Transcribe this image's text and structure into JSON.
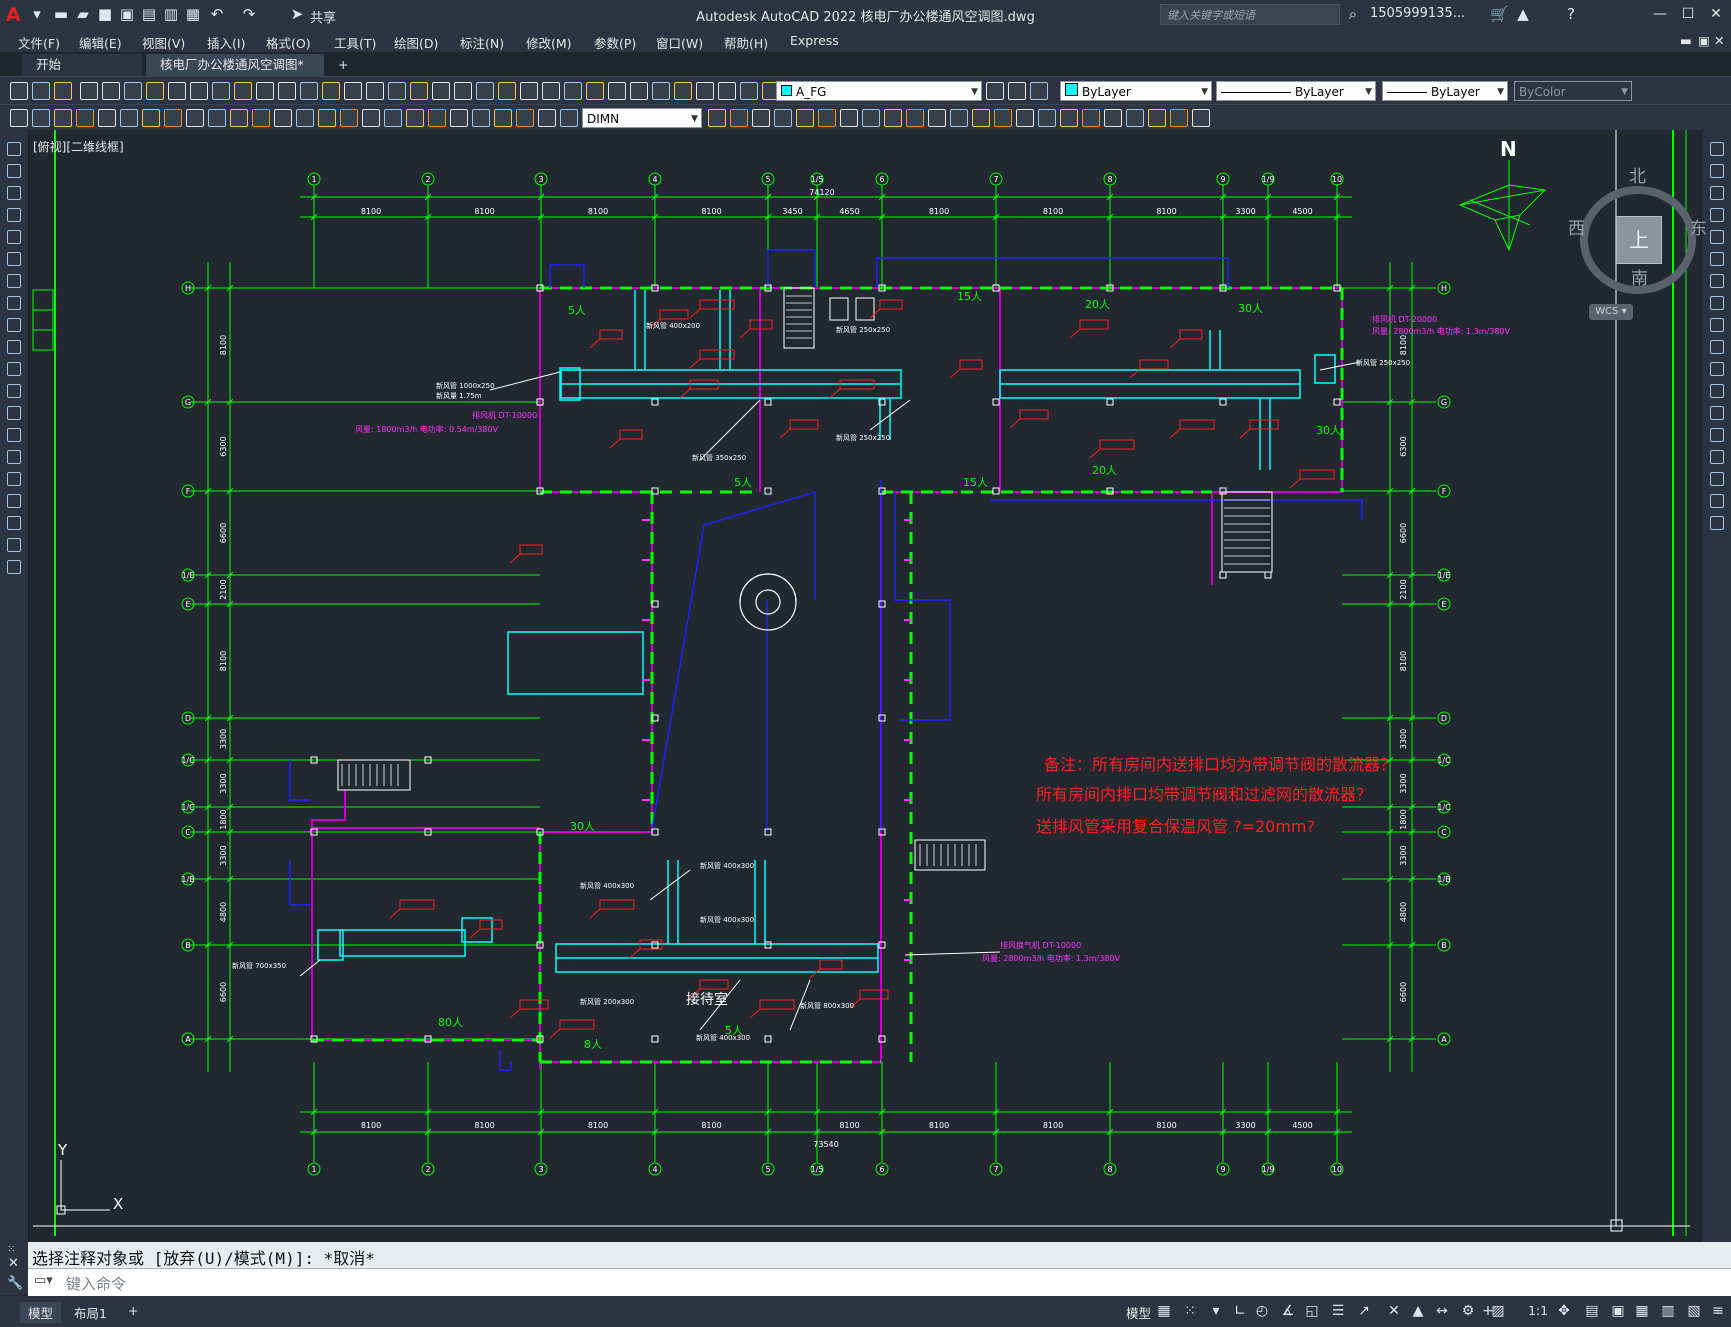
{
  "app": {
    "window_title": "Autodesk AutoCAD 2022    核电厂办公楼通风空调图.dwg",
    "share_label": "共享",
    "search_placeholder": "键入关键字或短语",
    "user": "1505999135...",
    "logo": "A"
  },
  "menu": [
    "文件(F)",
    "编辑(E)",
    "视图(V)",
    "插入(I)",
    "格式(O)",
    "工具(T)",
    "绘图(D)",
    "标注(N)",
    "修改(M)",
    "参数(P)",
    "窗口(W)",
    "帮助(H)",
    "Express"
  ],
  "tabs": {
    "start": "开始",
    "document": "核电厂办公楼通风空调图*",
    "add": "+"
  },
  "toolbar": {
    "layer": "A_FG",
    "color": "ByLayer",
    "linetype": "ByLayer",
    "lineweight": "ByLayer",
    "plotstyle": "ByColor",
    "dimstyle": "DIMN"
  },
  "viewport": {
    "label": "[俯视][二维线框]",
    "viewcube": {
      "north": "北",
      "south": "南",
      "east": "东",
      "west": "西",
      "top": "上",
      "wcs": "WCS"
    },
    "compass_n": "N",
    "ucs_x": "X",
    "ucs_y": "Y"
  },
  "drawing": {
    "grid_numbers": [
      "1",
      "2",
      "3",
      "4",
      "5",
      "1/5",
      "6",
      "7",
      "8",
      "9",
      "1/9",
      "10"
    ],
    "grid_letters": [
      "H",
      "G",
      "F",
      "1/E",
      "E",
      "D",
      "1/C",
      "1/C",
      "C",
      "1/B",
      "B",
      "A"
    ],
    "top_dims": [
      "8100",
      "8100",
      "8100",
      "8100",
      "3450",
      "4650",
      "8100",
      "8100",
      "8100",
      "3300",
      "4500"
    ],
    "bottom_dims": [
      "8100",
      "8100",
      "8100",
      "8100",
      "8100",
      "8100",
      "8100",
      "8100",
      "3300",
      "4500"
    ],
    "total_top": "74120",
    "total_bottom": "73540",
    "left_dims": [
      "8100",
      "6300",
      "6600",
      "2100",
      "8100",
      "3300",
      "3300",
      "1800",
      "3300",
      "4800",
      "6600"
    ],
    "notes": [
      "备注：所有房间内送排口均为带调节阀的散流器？",
      "所有房间内排口均带调节阀和过滤网的散流器？",
      "送排风管采用复合保温风管 ?=20mm?"
    ],
    "room_label": "接待室",
    "occupancy": [
      "5人",
      "15人",
      "20人",
      "30人",
      "5人",
      "15人",
      "20人",
      "30人",
      "80人",
      "30人",
      "8人",
      "5人"
    ]
  },
  "command": {
    "history": "选择注释对象或 [放弃(U)/模式(M)]: *取消*",
    "placeholder": "键入命令"
  },
  "status": {
    "model_tab": "模型",
    "layout_tab": "布局1",
    "model_space": "模型",
    "scale": "1:1"
  }
}
